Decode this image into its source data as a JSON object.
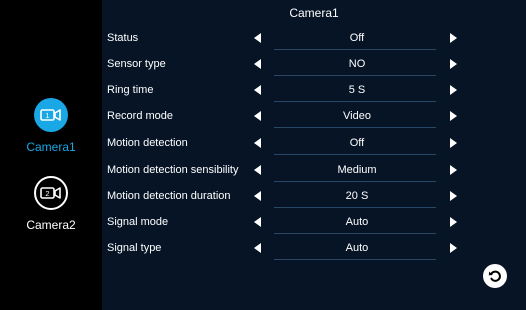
{
  "sidebar": {
    "cameras": [
      {
        "label": "Camera1",
        "icon": "camera-1-icon",
        "number": "1",
        "active": true
      },
      {
        "label": "Camera2",
        "icon": "camera-2-icon",
        "number": "2",
        "active": false
      }
    ]
  },
  "panel": {
    "title": "Camera1",
    "rows": [
      {
        "label": "Status",
        "value": "Off"
      },
      {
        "label": "Sensor type",
        "value": "NO"
      },
      {
        "label": "Ring time",
        "value": "5 S"
      },
      {
        "label": "Record mode",
        "value": "Video"
      },
      {
        "label": "Motion detection",
        "value": "Off"
      },
      {
        "label": "Motion detection sensibility",
        "value": "Medium"
      },
      {
        "label": "Motion detection duration",
        "value": "20 S"
      },
      {
        "label": "Signal mode",
        "value": "Auto"
      },
      {
        "label": "Signal type",
        "value": "Auto"
      }
    ]
  },
  "icons": {
    "prev": "left-arrow-icon",
    "next": "right-arrow-icon",
    "back": "back-icon"
  },
  "colors": {
    "accent": "#19a7e6",
    "panel_bg": "#061426",
    "sidebar_bg": "#000000",
    "divider": "#284866"
  }
}
